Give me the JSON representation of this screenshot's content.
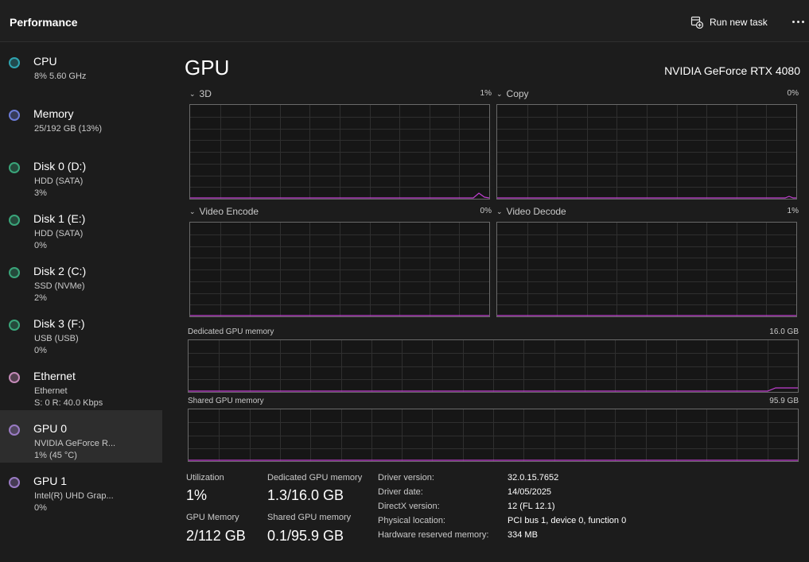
{
  "header": {
    "title": "Performance",
    "run_task_label": "Run new task"
  },
  "sidebar": {
    "items": [
      {
        "name": "CPU",
        "line1": "8%  5.60 GHz",
        "line2": "",
        "color": "#2fa4b0"
      },
      {
        "name": "Memory",
        "line1": "25/192 GB (13%)",
        "line2": "",
        "color": "#6b7bd6"
      },
      {
        "name": "Disk 0 (D:)",
        "line1": "HDD (SATA)",
        "line2": "3%",
        "color": "#3aa57a"
      },
      {
        "name": "Disk 1 (E:)",
        "line1": "HDD (SATA)",
        "line2": "0%",
        "color": "#3aa57a"
      },
      {
        "name": "Disk 2 (C:)",
        "line1": "SSD (NVMe)",
        "line2": "2%",
        "color": "#3aa57a"
      },
      {
        "name": "Disk 3 (F:)",
        "line1": "USB (USB)",
        "line2": "0%",
        "color": "#3aa57a"
      },
      {
        "name": "Ethernet",
        "line1": "Ethernet",
        "line2": "S: 0 R: 40.0 Kbps",
        "color": "#c48ab8"
      },
      {
        "name": "GPU 0",
        "line1": "NVIDIA GeForce R...",
        "line2": "1%  (45 °C)",
        "color": "#9a7bc4"
      },
      {
        "name": "GPU 1",
        "line1": "Intel(R) UHD Grap...",
        "line2": "0%",
        "color": "#9a7bc4"
      }
    ],
    "active_index": 7
  },
  "gpu": {
    "title": "GPU",
    "model": "NVIDIA GeForce RTX 4080",
    "engines": [
      {
        "label": "3D",
        "percent": "1%"
      },
      {
        "label": "Copy",
        "percent": "0%"
      },
      {
        "label": "Video Encode",
        "percent": "0%"
      },
      {
        "label": "Video Decode",
        "percent": "1%"
      }
    ],
    "dedicated_mem": {
      "label": "Dedicated GPU memory",
      "max": "16.0 GB"
    },
    "shared_mem": {
      "label": "Shared GPU memory",
      "max": "95.9 GB"
    },
    "line_color": "#c13fd1"
  },
  "stats": {
    "utilization": {
      "label": "Utilization",
      "value": "1%"
    },
    "dedicated": {
      "label": "Dedicated GPU memory",
      "value": "1.3/16.0 GB"
    },
    "gpu_memory": {
      "label": "GPU Memory",
      "value": "2/112 GB"
    },
    "shared": {
      "label": "Shared GPU memory",
      "value": "0.1/95.9 GB"
    }
  },
  "info": [
    {
      "key": "Driver version:",
      "value": "32.0.15.7652"
    },
    {
      "key": "Driver date:",
      "value": "14/05/2025"
    },
    {
      "key": "DirectX version:",
      "value": "12 (FL 12.1)"
    },
    {
      "key": "Physical location:",
      "value": "PCI bus 1, device 0, function 0"
    },
    {
      "key": "Hardware reserved memory:",
      "value": "334 MB"
    }
  ]
}
